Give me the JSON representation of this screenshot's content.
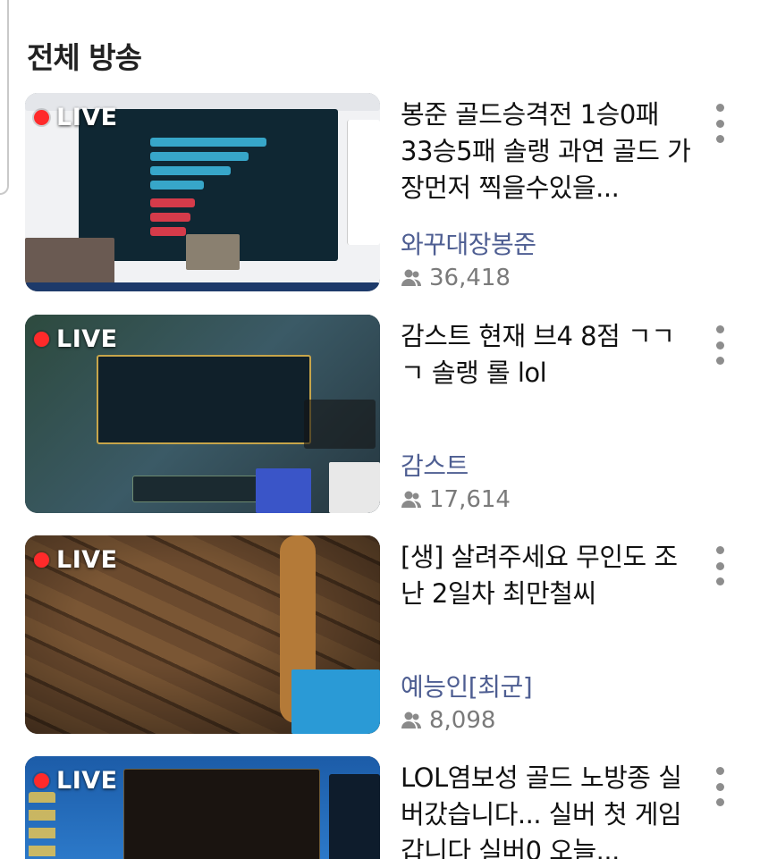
{
  "section": {
    "title": "전체 방송"
  },
  "live_label": "LIVE",
  "streams": [
    {
      "title": "봉준 골드승격전 1승0패 33승5패 솔랭 과연 골드 가장먼저 찍을수있을...",
      "channel": "와꾸대장봉준",
      "viewers": "36,418"
    },
    {
      "title": "감스트 현재 브4 8점 ㄱㄱㄱ 솔랭 롤 lol",
      "channel": "감스트",
      "viewers": "17,614"
    },
    {
      "title": "[생] 살려주세요 무인도 조난 2일차 최만철씨",
      "channel": "예능인[최군]",
      "viewers": "8,098"
    },
    {
      "title": "LOL염보성 골드 노방종 실버갔습니다... 실버 첫 게임갑니다 실버0 오늘...",
      "channel": "",
      "viewers": ""
    }
  ],
  "icons": {
    "viewer": "viewers-icon",
    "menu": "more-vertical-icon",
    "live": "live-dot-icon"
  },
  "colors": {
    "live_dot": "#ff2a2a",
    "channel": "#4e5e92",
    "viewer_text": "#7a7a7a"
  }
}
